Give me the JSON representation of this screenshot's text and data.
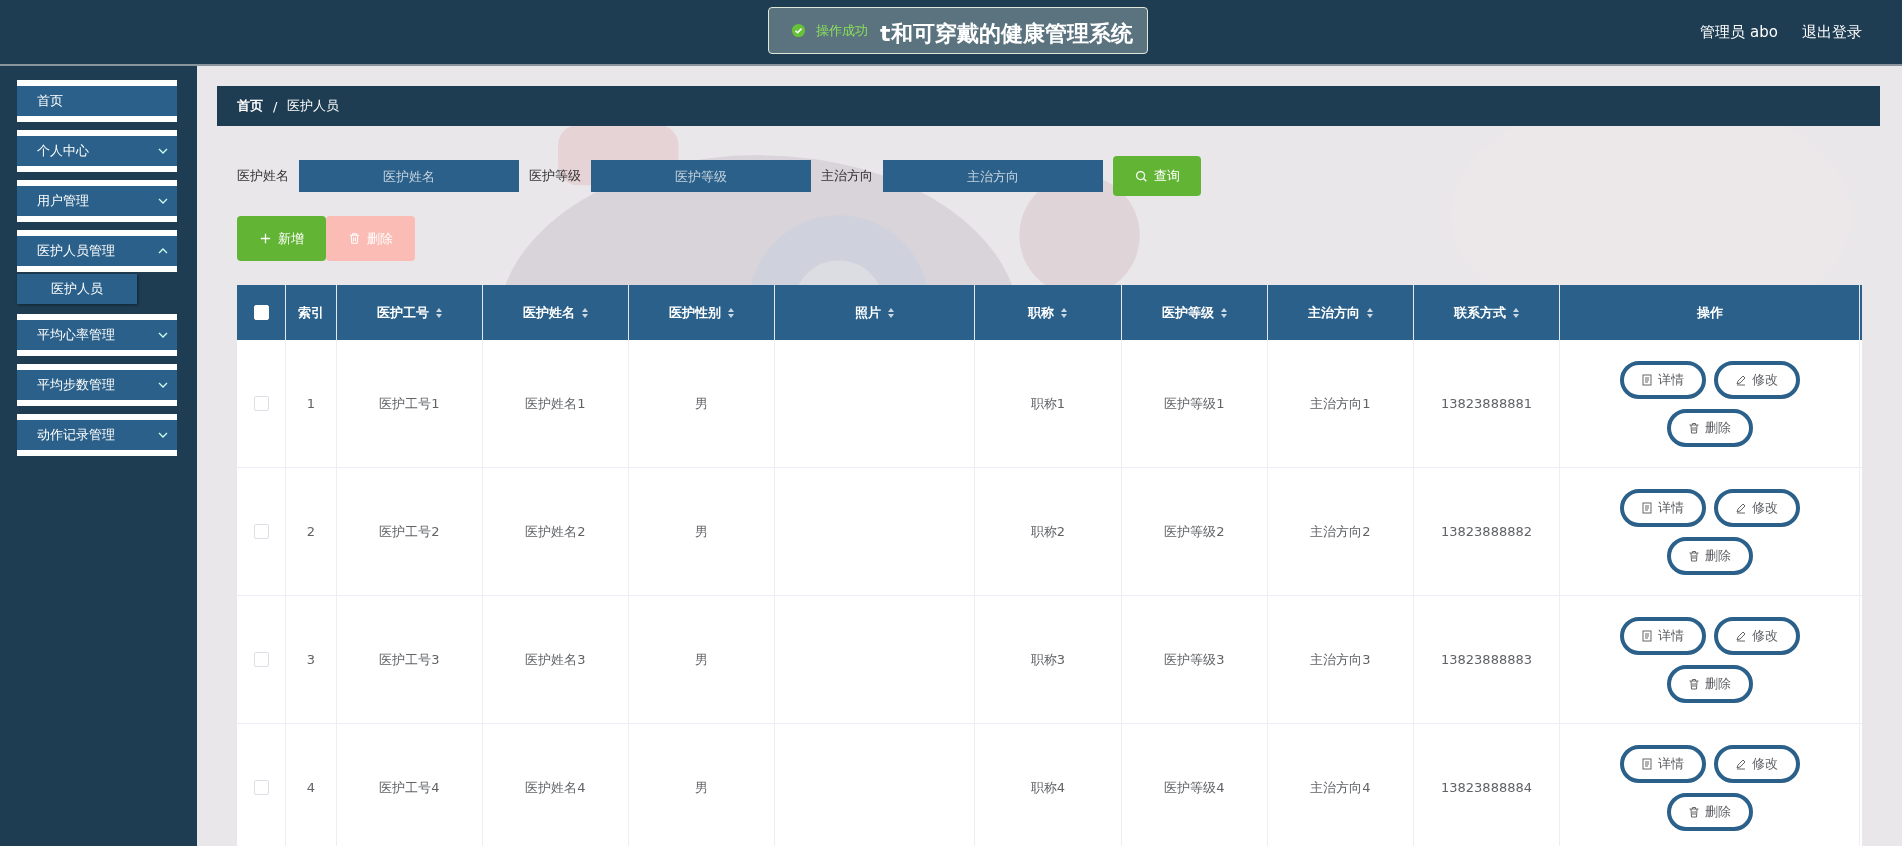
{
  "header": {
    "title": "t和可穿戴的健康管理系统",
    "user": "管理员 abo",
    "logout": "退出登录"
  },
  "toast": {
    "kind": "success",
    "message": "操作成功"
  },
  "sidebar": {
    "items": [
      {
        "label": "首页",
        "kind": "link"
      },
      {
        "label": "个人中心",
        "kind": "menu",
        "expanded": false
      },
      {
        "label": "用户管理",
        "kind": "menu",
        "expanded": false
      },
      {
        "label": "医护人员管理",
        "kind": "menu",
        "expanded": true,
        "children": [
          {
            "label": "医护人员"
          }
        ]
      },
      {
        "label": "平均心率管理",
        "kind": "menu",
        "expanded": false
      },
      {
        "label": "平均步数管理",
        "kind": "menu",
        "expanded": false
      },
      {
        "label": "动作记录管理",
        "kind": "menu",
        "expanded": false
      }
    ]
  },
  "breadcrumb": {
    "items": [
      "首页",
      "医护人员"
    ],
    "separator": "/"
  },
  "search": {
    "fields": [
      {
        "label": "医护姓名",
        "placeholder": "医护姓名"
      },
      {
        "label": "医护等级",
        "placeholder": "医护等级"
      },
      {
        "label": "主治方向",
        "placeholder": "主治方向"
      }
    ],
    "button": "查询"
  },
  "actions": [
    {
      "label": "新增",
      "kind": "add",
      "disabled": false
    },
    {
      "label": "删除",
      "kind": "delete",
      "disabled": true
    }
  ],
  "table": {
    "all_checked": false,
    "columns": [
      {
        "label": "索引",
        "sortable": false
      },
      {
        "label": "医护工号",
        "sortable": true
      },
      {
        "label": "医护姓名",
        "sortable": true
      },
      {
        "label": "医护性别",
        "sortable": true
      },
      {
        "label": "照片",
        "sortable": true
      },
      {
        "label": "职称",
        "sortable": true
      },
      {
        "label": "医护等级",
        "sortable": true
      },
      {
        "label": "主治方向",
        "sortable": true
      },
      {
        "label": "联系方式",
        "sortable": true
      },
      {
        "label": "操作",
        "sortable": false
      }
    ],
    "rows": [
      {
        "checked": false,
        "cells": [
          "1",
          "医护工号1",
          "医护姓名1",
          "男",
          "",
          "职称1",
          "医护等级1",
          "主治方向1",
          "13823888881"
        ],
        "actions": [
          {
            "label": "详情",
            "kind": "detail"
          },
          {
            "label": "修改",
            "kind": "edit"
          },
          {
            "label": "删除",
            "kind": "delete"
          }
        ]
      },
      {
        "checked": false,
        "cells": [
          "2",
          "医护工号2",
          "医护姓名2",
          "男",
          "",
          "职称2",
          "医护等级2",
          "主治方向2",
          "13823888882"
        ],
        "actions": [
          {
            "label": "详情",
            "kind": "detail"
          },
          {
            "label": "修改",
            "kind": "edit"
          },
          {
            "label": "删除",
            "kind": "delete"
          }
        ]
      },
      {
        "checked": false,
        "cells": [
          "3",
          "医护工号3",
          "医护姓名3",
          "男",
          "",
          "职称3",
          "医护等级3",
          "主治方向3",
          "13823888883"
        ],
        "actions": [
          {
            "label": "详情",
            "kind": "detail"
          },
          {
            "label": "修改",
            "kind": "edit"
          },
          {
            "label": "删除",
            "kind": "delete"
          }
        ]
      },
      {
        "checked": false,
        "cells": [
          "4",
          "医护工号4",
          "医护姓名4",
          "男",
          "",
          "职称4",
          "医护等级4",
          "主治方向4",
          "13823888884"
        ],
        "actions": [
          {
            "label": "详情",
            "kind": "detail"
          },
          {
            "label": "修改",
            "kind": "edit"
          },
          {
            "label": "删除",
            "kind": "delete"
          }
        ]
      }
    ]
  }
}
